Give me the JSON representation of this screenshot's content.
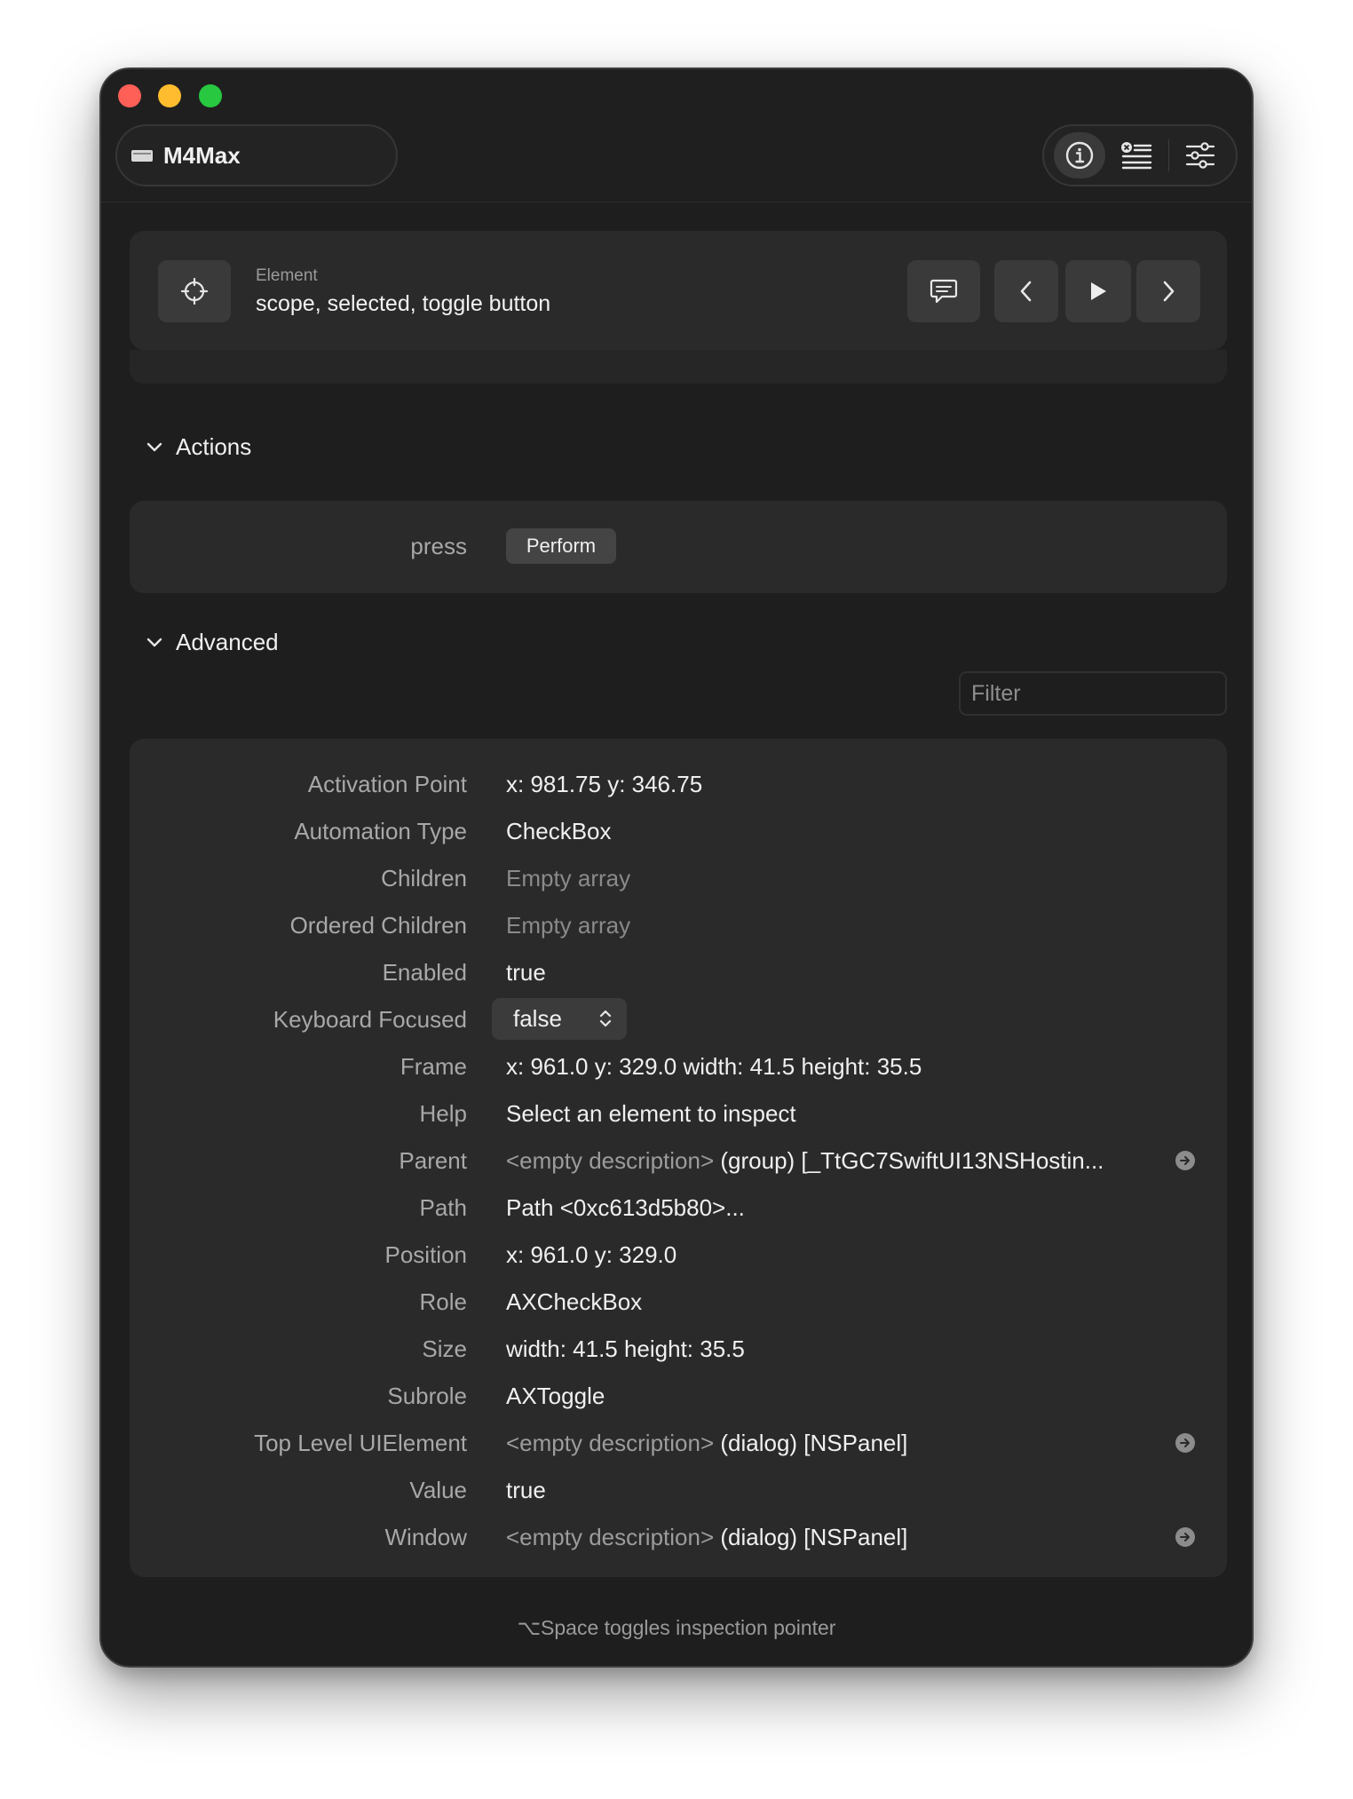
{
  "window": {
    "device_name": "M4Max",
    "toolbar": {
      "info_icon": "info-circle-icon",
      "list_icon": "list-with-badge-icon",
      "settings_icon": "sliders-icon"
    }
  },
  "element": {
    "caption": "Element",
    "value": "scope, selected, toggle button",
    "target_icon": "crosshair-icon",
    "speak_icon": "speech-bubble-icon",
    "prev_icon": "chevron-left-icon",
    "play_icon": "play-icon",
    "next_icon": "chevron-right-icon"
  },
  "actions": {
    "title": "Actions",
    "items": [
      {
        "name": "press",
        "button_label": "Perform"
      }
    ]
  },
  "advanced": {
    "title": "Advanced",
    "filter_placeholder": "Filter",
    "rows": [
      {
        "key": "Activation Point",
        "value": "x: 981.75  y: 346.75"
      },
      {
        "key": "Automation Type",
        "value": "CheckBox"
      },
      {
        "key": "Children",
        "value": "Empty array"
      },
      {
        "key": "Ordered Children",
        "value": "Empty array"
      },
      {
        "key": "Enabled",
        "value": "true"
      },
      {
        "key": "Keyboard Focused",
        "value": "false"
      },
      {
        "key": "Frame",
        "value": "x: 961.0  y: 329.0  width: 41.5  height: 35.5"
      },
      {
        "key": "Help",
        "value": "Select an element to inspect"
      },
      {
        "key": "Parent",
        "value_dim": "<empty description>",
        "value": "(group) [_TtGC7SwiftUI13NSHostin..."
      },
      {
        "key": "Path",
        "value": "Path <0xc613d5b80>..."
      },
      {
        "key": "Position",
        "value": "x: 961.0  y: 329.0"
      },
      {
        "key": "Role",
        "value": "AXCheckBox"
      },
      {
        "key": "Size",
        "value": "width: 41.5  height: 35.5"
      },
      {
        "key": "Subrole",
        "value": "AXToggle"
      },
      {
        "key": "Top Level UIElement",
        "value_dim": "<empty description>",
        "value": "(dialog) [NSPanel]"
      },
      {
        "key": "Value",
        "value": "true"
      },
      {
        "key": "Window",
        "value_dim": "<empty description>",
        "value": "(dialog) [NSPanel]"
      }
    ]
  },
  "footer": {
    "hint": "⌥Space toggles inspection pointer"
  },
  "colors": {
    "window_bg": "#1e1e1e",
    "card_bg": "#2a2a2a",
    "close": "#fe5f57",
    "minimize": "#febc2e",
    "maximize": "#28c840"
  }
}
